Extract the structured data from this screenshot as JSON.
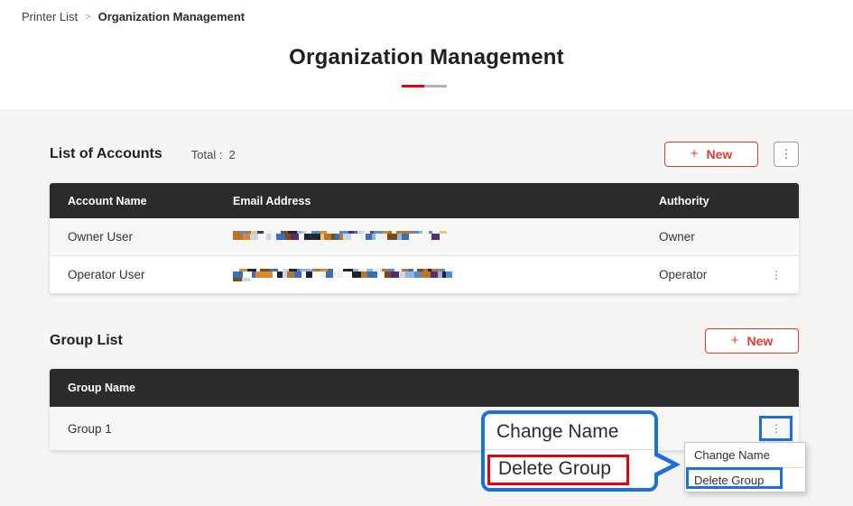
{
  "page": {
    "breadcrumb": {
      "parent": "Printer List",
      "separator": ">",
      "current": "Organization Management"
    },
    "title": "Organization Management"
  },
  "accounts_section": {
    "heading": "List of Accounts",
    "total_label": "Total :",
    "total_value": "2",
    "new_button_label": "New",
    "plus_glyph": "+",
    "table": {
      "columns": [
        "Account Name",
        "Email Address",
        "Authority"
      ],
      "rows": [
        {
          "account_name": "Owner User",
          "email_redacted": true,
          "authority": "Owner"
        },
        {
          "account_name": "Operator User",
          "email_redacted": true,
          "authority": "Operator"
        }
      ]
    }
  },
  "groups_section": {
    "heading": "Group List",
    "new_button_label": "New",
    "plus_glyph": "+",
    "table": {
      "columns": [
        "Group Name"
      ],
      "rows": [
        {
          "group_name": "Group 1"
        }
      ]
    }
  },
  "context_menu": {
    "items": [
      "Change Name",
      "Delete Group"
    ]
  },
  "callout": {
    "items": [
      "Change Name",
      "Delete Group"
    ]
  },
  "icons": {
    "kebab": "⋮"
  },
  "colors": {
    "accent_red": "#e8382d",
    "underline_red": "#e60012",
    "underline_gray": "#b3b3b3",
    "table_header_dark": "#2c2b2a",
    "annotation_blue": "#1b6fe0",
    "annotation_red": "#e60012"
  }
}
